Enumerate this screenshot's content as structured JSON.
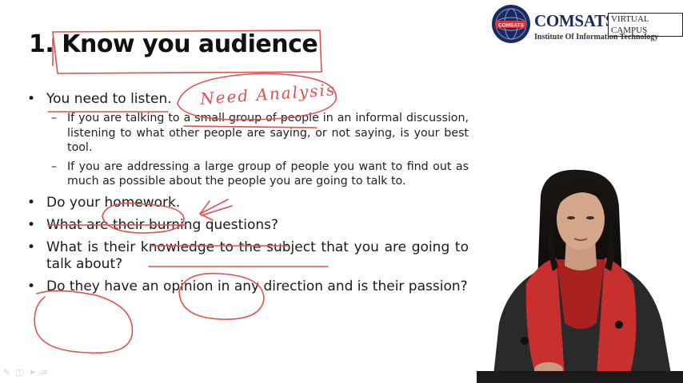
{
  "slide": {
    "title": "1. Know you audience",
    "bullets": [
      {
        "text": "You need to listen.",
        "sub": [
          "If you are talking to a small group of people in an informal discussion, listening to what other people are saying, or not saying, is your best tool.",
          "If you are addressing a large group of people you want to find out as much as possible about the people you are going to talk to."
        ]
      },
      {
        "text": "Do your homework."
      },
      {
        "text": "What are their burning questions?"
      },
      {
        "text": "What is their knowledge to the subject that you are going to talk about?"
      },
      {
        "text": "Do they have an opinion in any direction and is their passion?"
      }
    ]
  },
  "logo": {
    "name": "COMSATS",
    "badge": "VIRTUAL CAMPUS",
    "subtitle": "Institute Of Information Technology",
    "seal_text": "COMSATS"
  },
  "annotations": {
    "handwritten": "Need Analysis",
    "ink_color": "#e0504f"
  },
  "colors": {
    "brand_navy": "#1b2a5e",
    "text": "#1a1a1a",
    "ink": "#e0504f"
  }
}
